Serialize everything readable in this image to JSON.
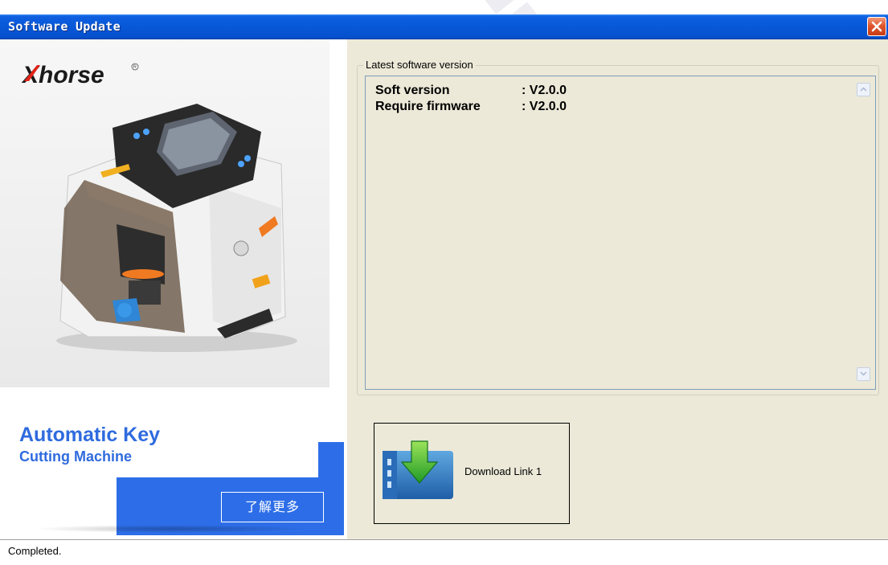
{
  "window": {
    "title": "Software Update"
  },
  "banner": {
    "logo_text": "Xhorse",
    "headline": "Automatic Key",
    "subheadline": "Cutting Machine",
    "learn_more_label": "了解更多"
  },
  "version_group": {
    "legend": "Latest software version",
    "rows": [
      {
        "key": "Soft version",
        "value": ": V2.0.0"
      },
      {
        "key": "Require firmware",
        "value": ": V2.0.0"
      }
    ]
  },
  "download": {
    "label": "Download Link 1",
    "icon": "download-arrow-icon"
  },
  "status": {
    "text": "Completed."
  },
  "colors": {
    "titlebar": "#0758d8",
    "brand_blue": "#2d6ee8",
    "dialog_bg": "#ece9d8",
    "close_red": "#e0562e"
  }
}
